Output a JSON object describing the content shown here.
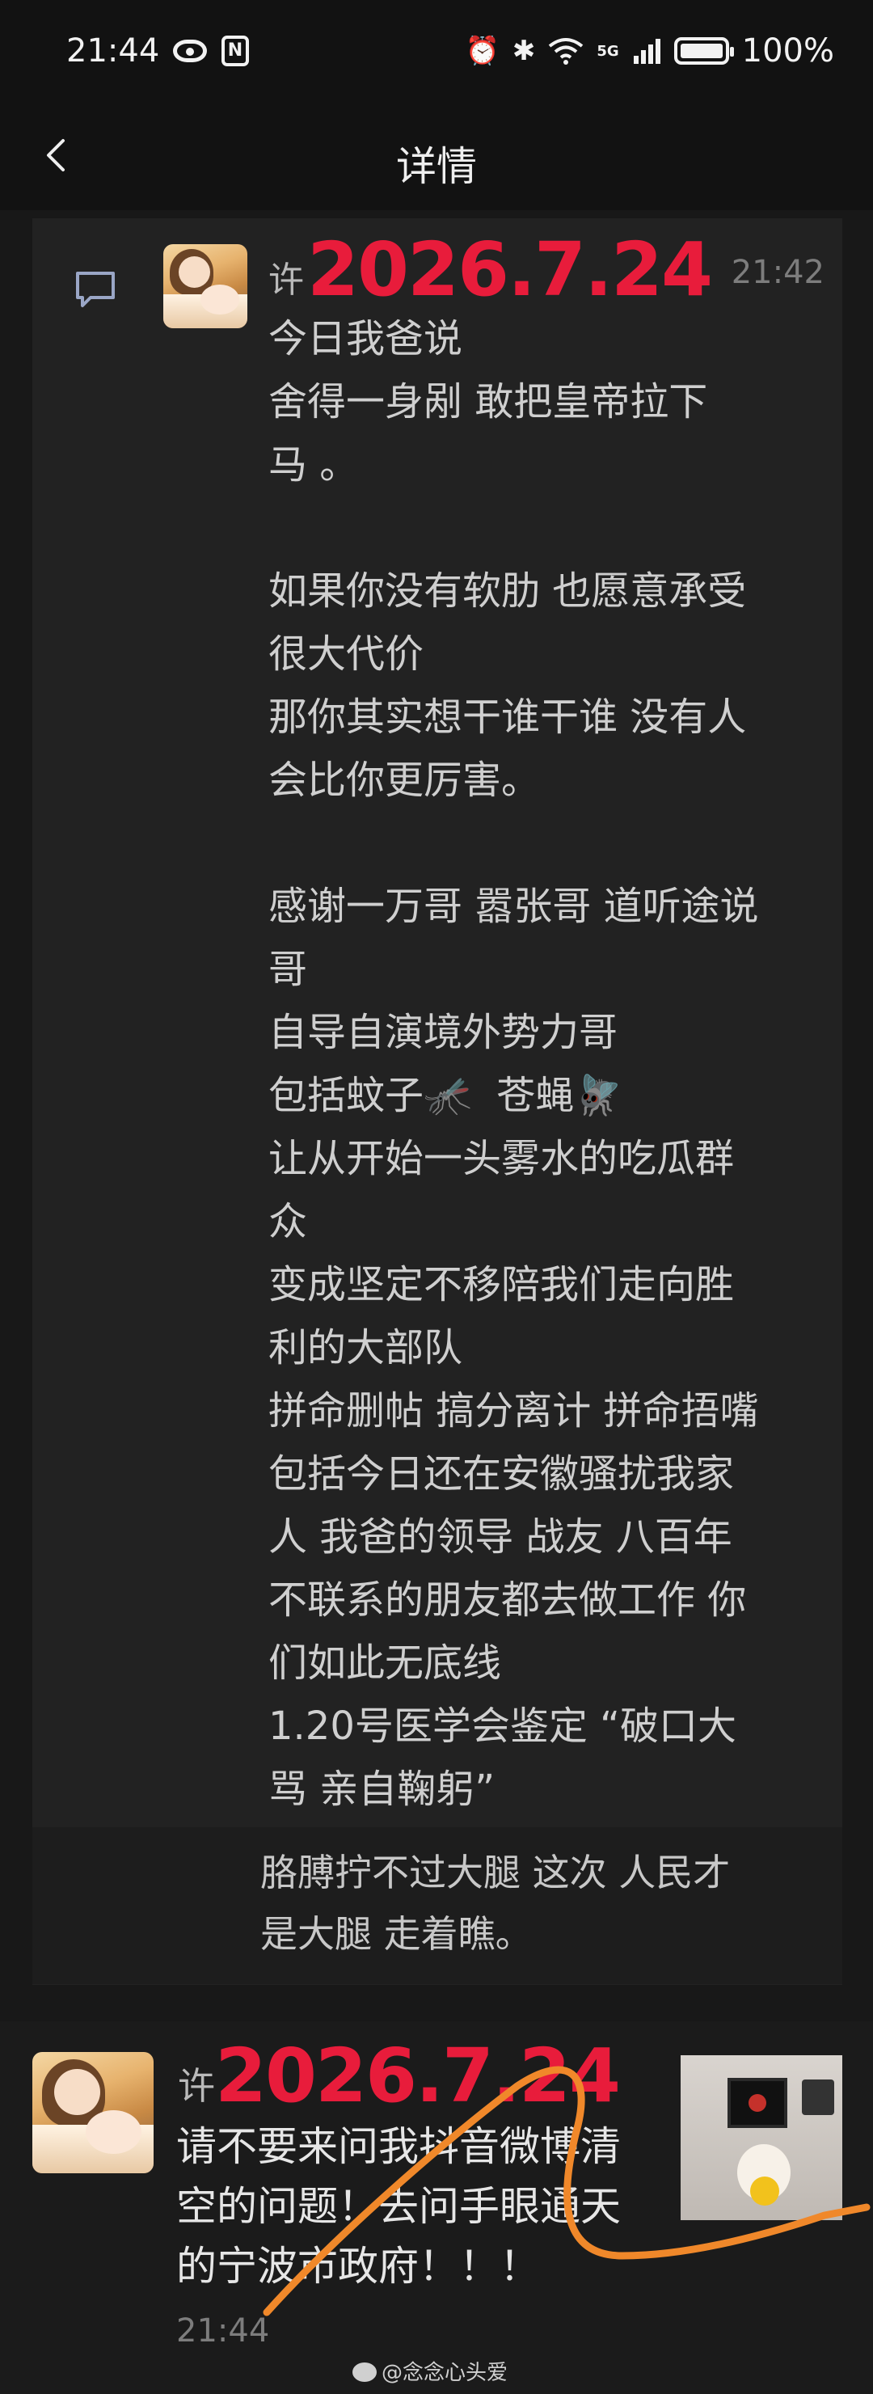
{
  "status_bar": {
    "time": "21:44",
    "network": "5G",
    "battery": "100%"
  },
  "header": {
    "title": "详情"
  },
  "message1": {
    "sender_initial": "许",
    "stamp": "2026.7.24",
    "time": "21:42",
    "body": "今日我爸说\n舍得一身剐 敢把皇帝拉下\n马 。\n\n如果你没有软肋 也愿意承受\n很大代价\n那你其实想干谁干谁 没有人\n会比你更厉害。\n\n感谢一万哥 嚣张哥 道听途说\n哥\n自导自演境外势力哥\n包括蚊子🦟  苍蝇🪰\n让从开始一头雾水的吃瓜群\n众\n变成坚定不移陪我们走向胜\n利的大部队\n拼命删帖 搞分离计 拼命捂嘴\n包括今日还在安徽骚扰我家\n人 我爸的领导 战友 八百年\n不联系的朋友都去做工作 你\n们如此无底线\n1.20号医学会鉴定 “破口大\n骂 亲自鞠躬”",
    "quote": "胳膊拧不过大腿 这次 人民才\n是大腿 走着瞧。"
  },
  "message2": {
    "sender_initial": "许",
    "stamp": "2026.7.24",
    "body": "请不要来问我抖音微博清\n空的问题！去问手眼通天\n的宁波市政府！！！",
    "time": "21:44"
  },
  "watermark": "@念念心头爱",
  "colors": {
    "stamp_red": "#e81c3b",
    "scribble_orange": "#f0882a",
    "background": "#181818"
  }
}
